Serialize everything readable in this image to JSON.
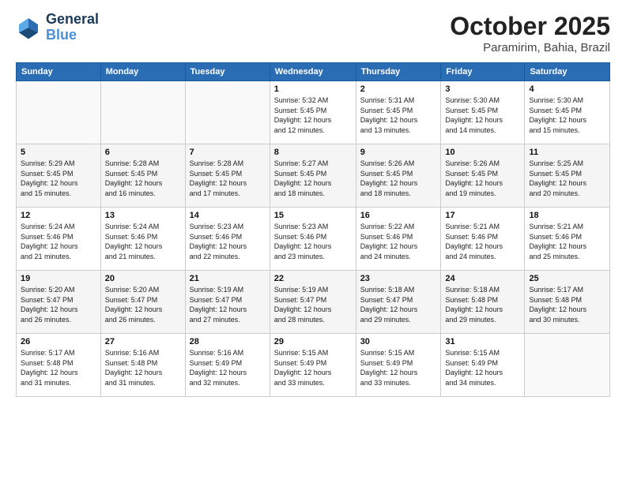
{
  "header": {
    "logo_line1": "General",
    "logo_line2": "Blue",
    "month": "October 2025",
    "location": "Paramirim, Bahia, Brazil"
  },
  "weekdays": [
    "Sunday",
    "Monday",
    "Tuesday",
    "Wednesday",
    "Thursday",
    "Friday",
    "Saturday"
  ],
  "weeks": [
    [
      {
        "day": "",
        "info": ""
      },
      {
        "day": "",
        "info": ""
      },
      {
        "day": "",
        "info": ""
      },
      {
        "day": "1",
        "info": "Sunrise: 5:32 AM\nSunset: 5:45 PM\nDaylight: 12 hours\nand 12 minutes."
      },
      {
        "day": "2",
        "info": "Sunrise: 5:31 AM\nSunset: 5:45 PM\nDaylight: 12 hours\nand 13 minutes."
      },
      {
        "day": "3",
        "info": "Sunrise: 5:30 AM\nSunset: 5:45 PM\nDaylight: 12 hours\nand 14 minutes."
      },
      {
        "day": "4",
        "info": "Sunrise: 5:30 AM\nSunset: 5:45 PM\nDaylight: 12 hours\nand 15 minutes."
      }
    ],
    [
      {
        "day": "5",
        "info": "Sunrise: 5:29 AM\nSunset: 5:45 PM\nDaylight: 12 hours\nand 15 minutes."
      },
      {
        "day": "6",
        "info": "Sunrise: 5:28 AM\nSunset: 5:45 PM\nDaylight: 12 hours\nand 16 minutes."
      },
      {
        "day": "7",
        "info": "Sunrise: 5:28 AM\nSunset: 5:45 PM\nDaylight: 12 hours\nand 17 minutes."
      },
      {
        "day": "8",
        "info": "Sunrise: 5:27 AM\nSunset: 5:45 PM\nDaylight: 12 hours\nand 18 minutes."
      },
      {
        "day": "9",
        "info": "Sunrise: 5:26 AM\nSunset: 5:45 PM\nDaylight: 12 hours\nand 18 minutes."
      },
      {
        "day": "10",
        "info": "Sunrise: 5:26 AM\nSunset: 5:45 PM\nDaylight: 12 hours\nand 19 minutes."
      },
      {
        "day": "11",
        "info": "Sunrise: 5:25 AM\nSunset: 5:45 PM\nDaylight: 12 hours\nand 20 minutes."
      }
    ],
    [
      {
        "day": "12",
        "info": "Sunrise: 5:24 AM\nSunset: 5:46 PM\nDaylight: 12 hours\nand 21 minutes."
      },
      {
        "day": "13",
        "info": "Sunrise: 5:24 AM\nSunset: 5:46 PM\nDaylight: 12 hours\nand 21 minutes."
      },
      {
        "day": "14",
        "info": "Sunrise: 5:23 AM\nSunset: 5:46 PM\nDaylight: 12 hours\nand 22 minutes."
      },
      {
        "day": "15",
        "info": "Sunrise: 5:23 AM\nSunset: 5:46 PM\nDaylight: 12 hours\nand 23 minutes."
      },
      {
        "day": "16",
        "info": "Sunrise: 5:22 AM\nSunset: 5:46 PM\nDaylight: 12 hours\nand 24 minutes."
      },
      {
        "day": "17",
        "info": "Sunrise: 5:21 AM\nSunset: 5:46 PM\nDaylight: 12 hours\nand 24 minutes."
      },
      {
        "day": "18",
        "info": "Sunrise: 5:21 AM\nSunset: 5:46 PM\nDaylight: 12 hours\nand 25 minutes."
      }
    ],
    [
      {
        "day": "19",
        "info": "Sunrise: 5:20 AM\nSunset: 5:47 PM\nDaylight: 12 hours\nand 26 minutes."
      },
      {
        "day": "20",
        "info": "Sunrise: 5:20 AM\nSunset: 5:47 PM\nDaylight: 12 hours\nand 26 minutes."
      },
      {
        "day": "21",
        "info": "Sunrise: 5:19 AM\nSunset: 5:47 PM\nDaylight: 12 hours\nand 27 minutes."
      },
      {
        "day": "22",
        "info": "Sunrise: 5:19 AM\nSunset: 5:47 PM\nDaylight: 12 hours\nand 28 minutes."
      },
      {
        "day": "23",
        "info": "Sunrise: 5:18 AM\nSunset: 5:47 PM\nDaylight: 12 hours\nand 29 minutes."
      },
      {
        "day": "24",
        "info": "Sunrise: 5:18 AM\nSunset: 5:48 PM\nDaylight: 12 hours\nand 29 minutes."
      },
      {
        "day": "25",
        "info": "Sunrise: 5:17 AM\nSunset: 5:48 PM\nDaylight: 12 hours\nand 30 minutes."
      }
    ],
    [
      {
        "day": "26",
        "info": "Sunrise: 5:17 AM\nSunset: 5:48 PM\nDaylight: 12 hours\nand 31 minutes."
      },
      {
        "day": "27",
        "info": "Sunrise: 5:16 AM\nSunset: 5:48 PM\nDaylight: 12 hours\nand 31 minutes."
      },
      {
        "day": "28",
        "info": "Sunrise: 5:16 AM\nSunset: 5:49 PM\nDaylight: 12 hours\nand 32 minutes."
      },
      {
        "day": "29",
        "info": "Sunrise: 5:15 AM\nSunset: 5:49 PM\nDaylight: 12 hours\nand 33 minutes."
      },
      {
        "day": "30",
        "info": "Sunrise: 5:15 AM\nSunset: 5:49 PM\nDaylight: 12 hours\nand 33 minutes."
      },
      {
        "day": "31",
        "info": "Sunrise: 5:15 AM\nSunset: 5:49 PM\nDaylight: 12 hours\nand 34 minutes."
      },
      {
        "day": "",
        "info": ""
      }
    ]
  ]
}
